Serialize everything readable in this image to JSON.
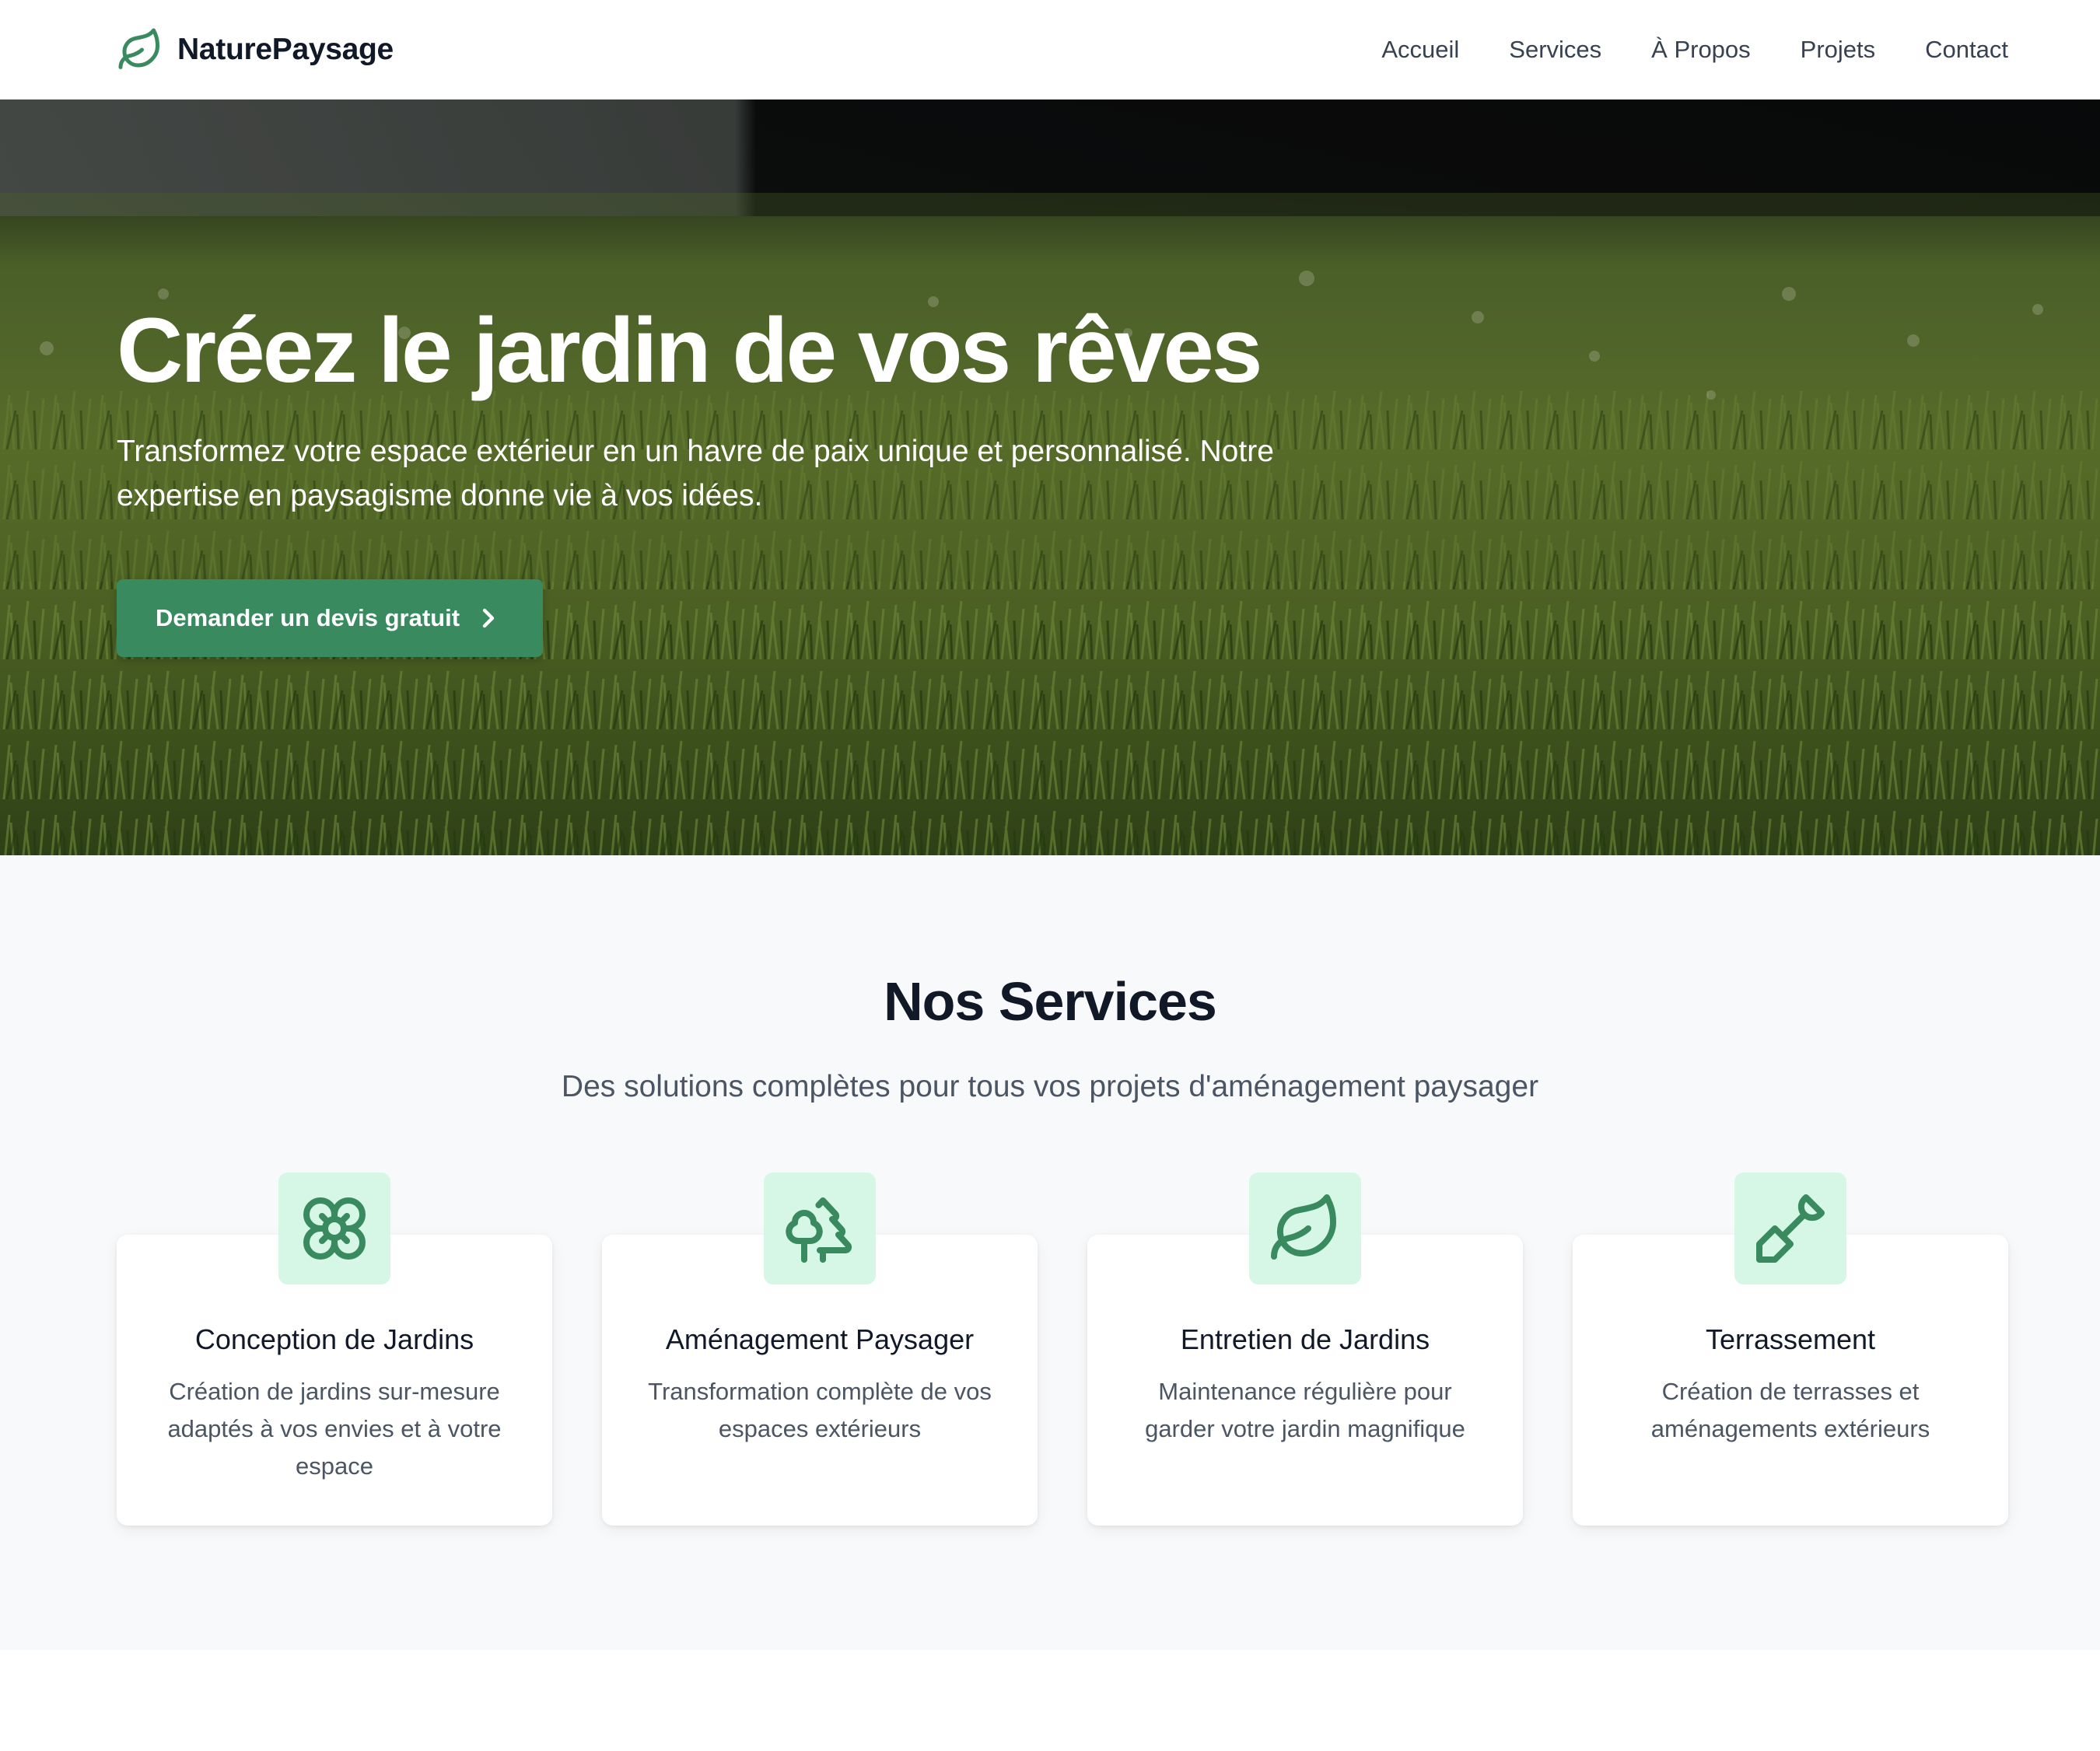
{
  "brand": {
    "name": "NaturePaysage",
    "icon": "leaf-icon",
    "color": "#3a8a60"
  },
  "nav": {
    "items": [
      {
        "label": "Accueil"
      },
      {
        "label": "Services"
      },
      {
        "label": "À Propos"
      },
      {
        "label": "Projets"
      },
      {
        "label": "Contact"
      }
    ]
  },
  "hero": {
    "title": "Créez le jardin de vos rêves",
    "subtitle": "Transformez votre espace extérieur en un havre de paix unique et personnalisé. Notre expertise en paysagisme donne vie à vos idées.",
    "cta_label": "Demander un devis gratuit",
    "cta_icon": "chevron-right-icon",
    "background": "grass-photo"
  },
  "services": {
    "title": "Nos Services",
    "subtitle": "Des solutions complètes pour tous vos projets d'aménagement paysager",
    "items": [
      {
        "icon": "flower-icon",
        "title": "Conception de Jardins",
        "description": "Création de jardins sur-mesure adaptés à vos envies et à votre espace"
      },
      {
        "icon": "trees-icon",
        "title": "Aménagement Paysager",
        "description": "Transformation complète de vos espaces extérieurs"
      },
      {
        "icon": "leaf-icon",
        "title": "Entretien de Jardins",
        "description": "Maintenance régulière pour garder votre jardin magnifique"
      },
      {
        "icon": "shovel-icon",
        "title": "Terrassement",
        "description": "Création de terrasses et aménagements extérieurs"
      }
    ]
  },
  "colors": {
    "accent": "#3a8a60",
    "icon_tile": "#d6f7e6",
    "section_bg": "#f8f9fb",
    "heading": "#111827",
    "muted_text": "#4b5563"
  }
}
